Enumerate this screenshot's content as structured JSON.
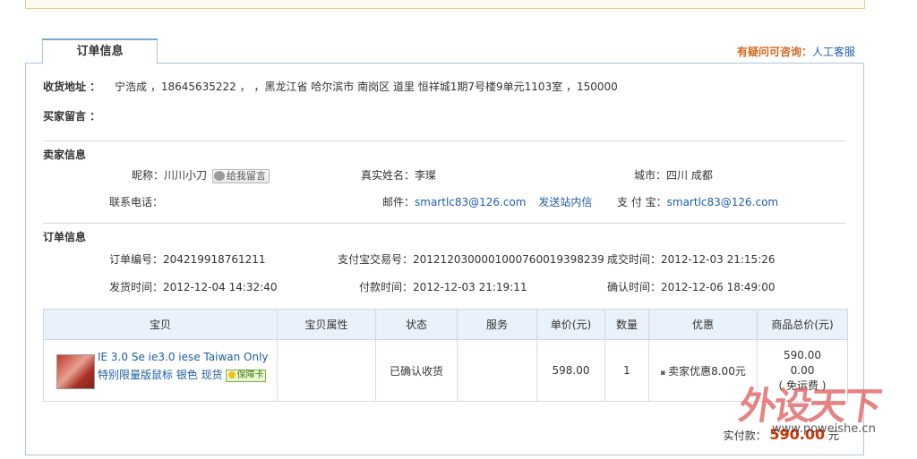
{
  "tab": {
    "label": "订单信息"
  },
  "help": {
    "question": "有疑问可咨询：",
    "link": "人工客服"
  },
  "shipping": {
    "label": "收货地址 ：",
    "value": "宁浩成 ，18645635222 ， ，黑龙江省 哈尔滨市 南岗区 道里 恒祥城1期7号楼9单元1103室 ，150000"
  },
  "buyer_message": {
    "label": "买家留言 ："
  },
  "seller": {
    "title": "卖家信息",
    "nickname_label": "昵称：",
    "nickname": "川川小刀",
    "message_button": "给我留言",
    "realname_label": "真实姓名：",
    "realname": "李璨",
    "city_label": "城市：",
    "city": "四川 成都",
    "phone_label": "联系电话：",
    "email_label": "邮件：",
    "email": "smartlc83@126.com",
    "site_msg": "发送站内信",
    "alipay_label": "支 付 宝：",
    "alipay": "smartlc83@126.com"
  },
  "order": {
    "title": "订单信息",
    "order_no_label": "订单编号：",
    "order_no": "204219918761211",
    "alipay_trade_label": "支付宝交易号：",
    "alipay_trade": "2012120300001000760019398239",
    "deal_time_label": "成交时间：",
    "deal_time": "2012-12-03 21:15:26",
    "ship_time_label": "发货时间：",
    "ship_time": "2012-12-04 14:32:40",
    "pay_time_label": "付款时间：",
    "pay_time": "2012-12-03 21:19:11",
    "confirm_time_label": "确认时间：",
    "confirm_time": "2012-12-06 18:49:00"
  },
  "table": {
    "headers": [
      "宝贝",
      "宝贝属性",
      "状态",
      "服务",
      "单价(元)",
      "数量",
      "优惠",
      "商品总价(元)"
    ],
    "item": {
      "title": "IE 3.0 Se ie3.0 iese Taiwan Only 特别限量版鼠标 银色 现货",
      "badge": "保障卡",
      "attributes": "",
      "status": "已确认收货",
      "service": "",
      "unit_price": "598.00",
      "quantity": "1",
      "discount": "卖家优惠8.00元",
      "total": "590.00",
      "shipping_fee": "0.00",
      "shipping_note": "( 免运费 )"
    }
  },
  "paid": {
    "label": "实付款：",
    "amount": "590.00",
    "unit": "元"
  },
  "watermark": {
    "brand": "外设天下",
    "url": "www.poweishe.cn"
  }
}
